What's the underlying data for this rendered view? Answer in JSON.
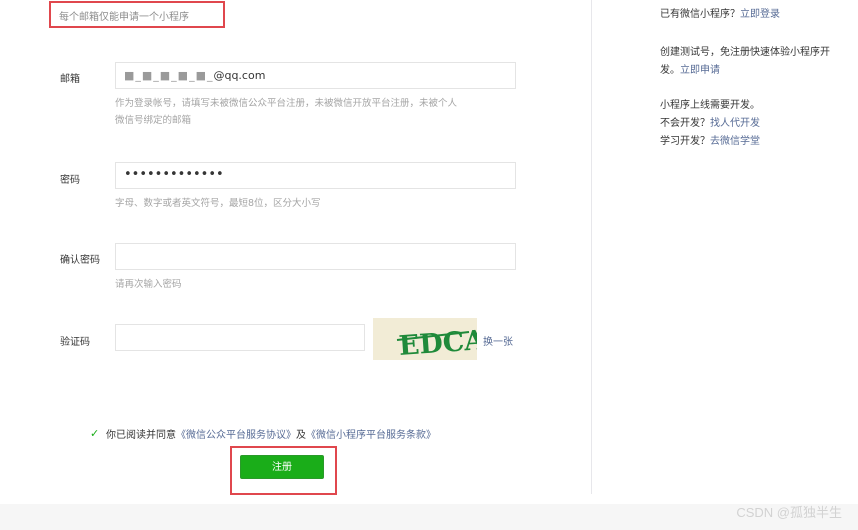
{
  "notice": "每个邮箱仅能申请一个小程序",
  "form": {
    "email": {
      "label": "邮箱",
      "value_mask": "■_■_■_■_■_",
      "value_suffix": "@qq.com",
      "hint_line1": "作为登录帐号，请填写未被微信公众平台注册，未被微信开放平台注册，未被个人",
      "hint_line2": "微信号绑定的邮箱"
    },
    "password": {
      "label": "密码",
      "value": "•••••••••••••",
      "hint": "字母、数字或者英文符号，最短8位，区分大小写"
    },
    "confirm_password": {
      "label": "确认密码",
      "value": "",
      "hint": "请再次输入密码"
    },
    "captcha": {
      "label": "验证码",
      "value": "",
      "image_text": "EDCA",
      "refresh_label": "换一张"
    }
  },
  "agreement": {
    "checkbox_icon": "checkmark-icon",
    "prefix": "你已阅读并同意",
    "link1": "《微信公众平台服务协议》",
    "and": "及",
    "link2": "《微信小程序平台服务条款》"
  },
  "register_button": "注册",
  "sidebar": {
    "line1_text": "已有微信小程序？",
    "line1_link": "立即登录",
    "line2_text": "创建测试号，免注册快速体验小程序开",
    "line3_text": "发。",
    "line3_link": "立即申请",
    "line4_text": "小程序上线需要开发。",
    "line5_text": "不会开发？",
    "line5_link": "找人代开发",
    "line6_text": "学习开发？",
    "line6_link": "去微信学堂"
  },
  "watermark": "CSDN @孤独半生",
  "colors": {
    "accent_green": "#1aad19",
    "link_blue": "#576b95",
    "highlight_red": "#e0474d"
  }
}
